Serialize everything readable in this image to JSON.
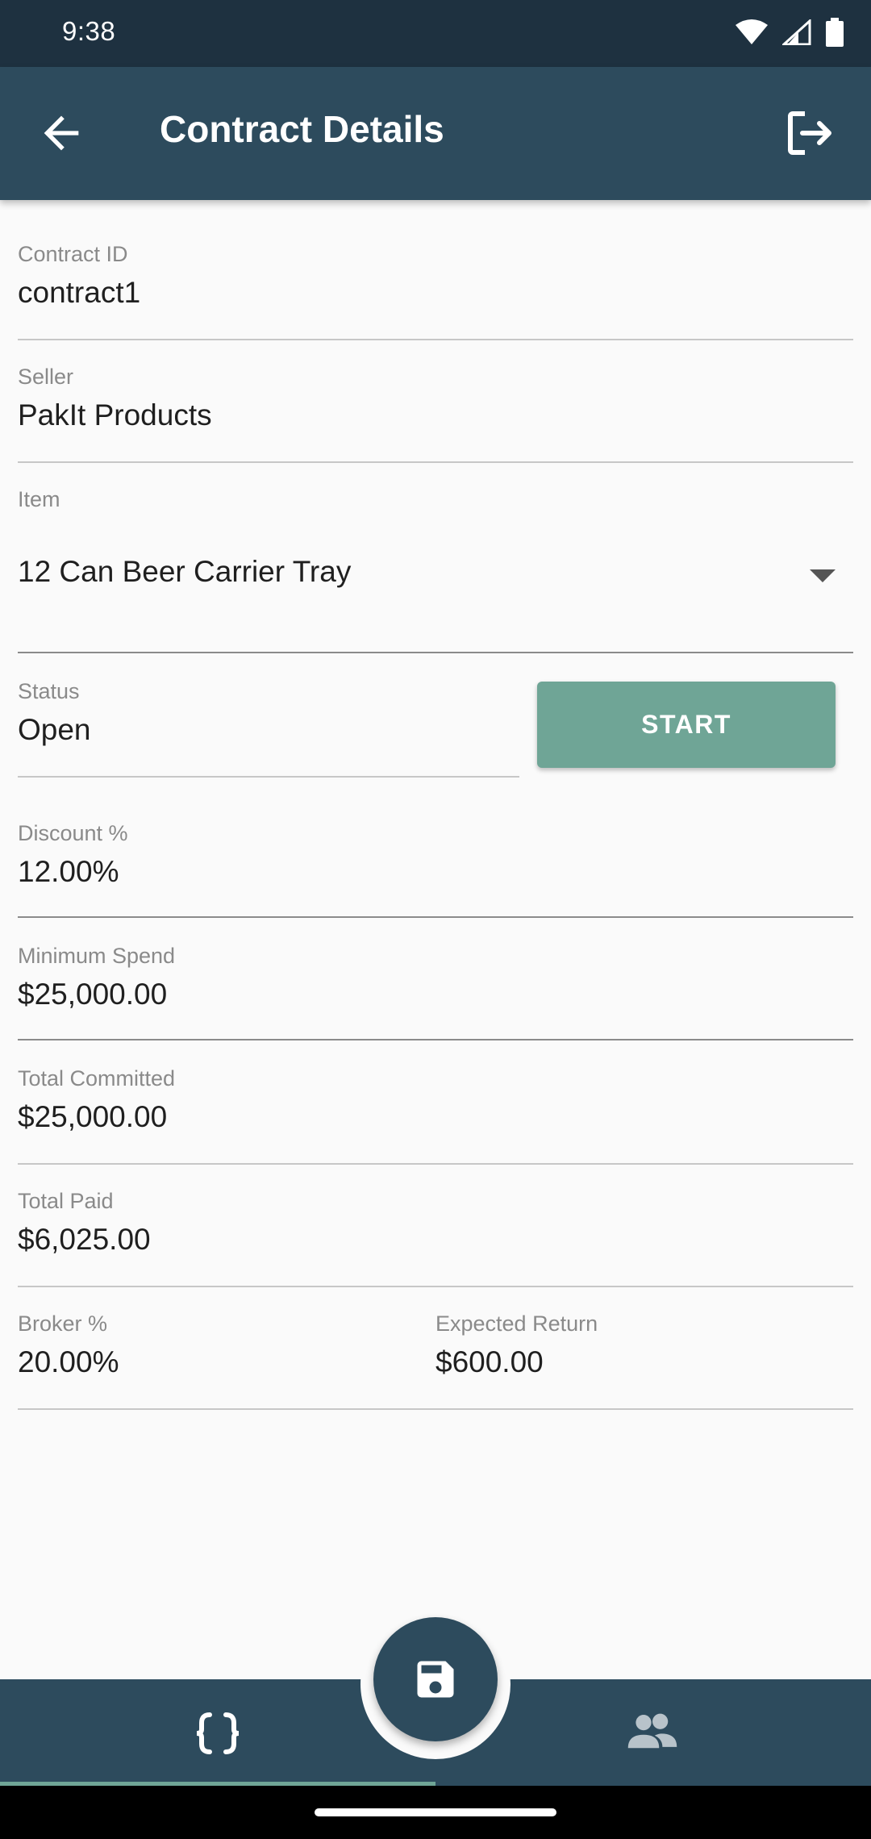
{
  "status_bar": {
    "time": "9:38",
    "icons": [
      "wifi-icon",
      "cell-signal-icon",
      "battery-icon"
    ]
  },
  "app_bar": {
    "title": "Contract Details",
    "back_icon": "arrow-back-icon",
    "action_icon": "logout-icon"
  },
  "fields": {
    "contract_id": {
      "label": "Contract ID",
      "value": "contract1"
    },
    "seller": {
      "label": "Seller",
      "value": "PakIt Products"
    },
    "item": {
      "label": "Item",
      "value": "12 Can Beer Carrier Tray"
    },
    "status": {
      "label": "Status",
      "value": "Open"
    },
    "discount": {
      "label": "Discount %",
      "value": "12.00%"
    },
    "minimum_spend": {
      "label": "Minimum Spend",
      "value": "$25,000.00"
    },
    "total_committed": {
      "label": "Total Committed",
      "value": "$25,000.00"
    },
    "total_paid": {
      "label": "Total Paid",
      "value": "$6,025.00"
    },
    "broker": {
      "label": "Broker %",
      "value": "20.00%"
    },
    "expected_return": {
      "label": "Expected Return",
      "value": "$600.00"
    }
  },
  "start_button": {
    "label": "START"
  },
  "bottom_nav": {
    "items": [
      {
        "icon": "code-braces-icon",
        "selected": true
      },
      {
        "icon": "people-icon",
        "selected": false
      }
    ],
    "fab_icon": "save-icon"
  },
  "colors": {
    "app_bar": "#2d4b5d",
    "status_bar": "#1e3140",
    "accent": "#6fa596",
    "background": "#fafafa"
  }
}
